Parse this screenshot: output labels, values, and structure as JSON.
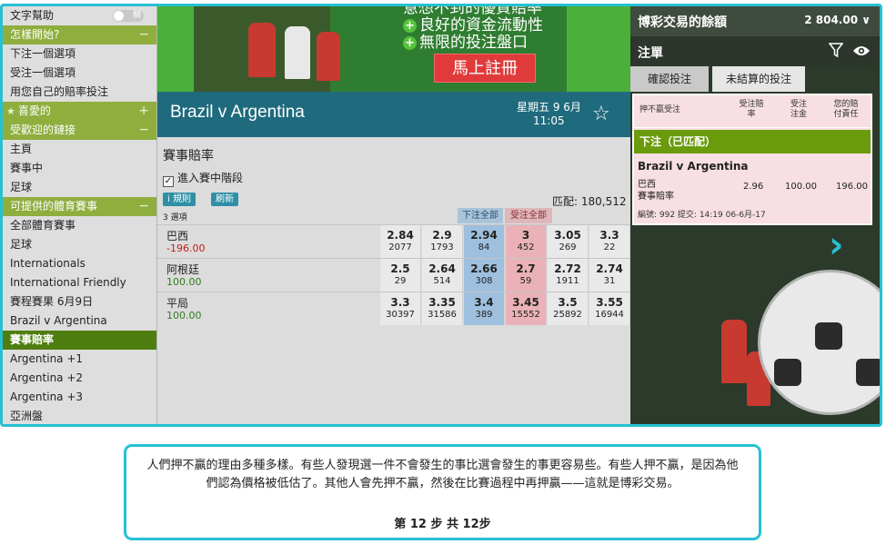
{
  "sidebar": {
    "text_help": "文字幫助",
    "toggle_label": "關",
    "sections": [
      {
        "id": "how-to-start",
        "title": "怎樣開始?",
        "sign": "−",
        "items": [
          "下注一個選項",
          "受注一個選項",
          "用您自己的賠率投注"
        ]
      },
      {
        "id": "favourites",
        "title": "喜愛的",
        "sign": "+",
        "items": []
      },
      {
        "id": "popular-links",
        "title": "受歡迎的鏈接",
        "sign": "−",
        "items": [
          "主頁",
          "賽事中",
          "足球"
        ]
      },
      {
        "id": "sports",
        "title": "可提供的體育賽事",
        "sign": "−",
        "items": [
          "全部體育賽事",
          "足球",
          "Internationals",
          "International Friendly",
          "賽程賽果 6月9日",
          "Brazil v Argentina"
        ]
      }
    ],
    "active_item": "賽事賠率",
    "after_active": [
      "Argentina +1",
      "Argentina +2",
      "Argentina +3",
      "亞洲盤"
    ]
  },
  "banner": {
    "line1": "意想不到的優質賠率",
    "line2": "良好的資金流動性",
    "line3": "無限的投注盤口",
    "cta": "馬上註冊"
  },
  "event": {
    "title": "Brazil v Argentina",
    "day": "星期五 9 6月",
    "time": "11:05"
  },
  "market": {
    "title": "賽事賠率",
    "inplay_label": "進入賽中階段",
    "rules_label": "規則",
    "refresh_label": "刷新",
    "matched": "匹配: 180,512",
    "selections": "3 選項",
    "back_all": "下注全部",
    "lay_all": "受注全部",
    "runners": [
      {
        "name": "巴西",
        "pnl": "-196.00",
        "pnl_type": "neg",
        "prices": [
          [
            "2.84",
            "2077"
          ],
          [
            "2.9",
            "1793"
          ],
          [
            "2.94",
            "84"
          ],
          [
            "3",
            "452"
          ],
          [
            "3.05",
            "269"
          ],
          [
            "3.3",
            "22"
          ]
        ]
      },
      {
        "name": "阿根廷",
        "pnl": "100.00",
        "pnl_type": "pos",
        "prices": [
          [
            "2.5",
            "29"
          ],
          [
            "2.64",
            "514"
          ],
          [
            "2.66",
            "308"
          ],
          [
            "2.7",
            "59"
          ],
          [
            "2.72",
            "1911"
          ],
          [
            "2.74",
            "31"
          ]
        ]
      },
      {
        "name": "平局",
        "pnl": "100.00",
        "pnl_type": "pos",
        "prices": [
          [
            "3.3",
            "30397"
          ],
          [
            "3.35",
            "31586"
          ],
          [
            "3.4",
            "389"
          ],
          [
            "3.45",
            "15552"
          ],
          [
            "3.5",
            "25892"
          ],
          [
            "3.55",
            "16944"
          ]
        ]
      }
    ]
  },
  "right_panel": {
    "balance_label": "博彩交易的餘額",
    "balance_value": "2 804.00 ∨",
    "slip_title": "注單",
    "tab_confirm": "確認投注",
    "tab_unsettled": "未結算的投注",
    "headers": {
      "lay": "押不贏受注",
      "odds": "受注賠率",
      "stake": "受注注金",
      "liability": "您的賠付責任"
    },
    "matched_bar": "下注（已匹配）",
    "bet": {
      "event": "Brazil v Argentina",
      "runner": "巴西",
      "market": "賽事賠率",
      "odds": "2.96",
      "stake": "100.00",
      "liability": "196.00",
      "footer": "編號: 992 提交: 14:19 06-6月-17"
    }
  },
  "instruction": {
    "text": "人們押不贏的理由多種多樣。有些人發現選一件不會發生的事比選會發生的事更容易些。有些人押不贏，是因為他們認為價格被低估了。其他人會先押不贏，然後在比賽過程中再押贏——這就是博彩交易。",
    "step": "第 12 步 共 12步"
  },
  "colors": {
    "accent_cyan": "#26c0d3",
    "sidebar_green": "#8fae3e",
    "active_green": "#4f7e10",
    "header_teal": "#1f6b7d",
    "back_blue": "#9ec0de",
    "lay_pink": "#eab2b8",
    "matched_green": "#6a9b0c"
  },
  "icons": [
    "star-icon",
    "filter-icon",
    "eye-icon",
    "checkbox-icon",
    "chevron-right-icon",
    "plus-icon"
  ]
}
